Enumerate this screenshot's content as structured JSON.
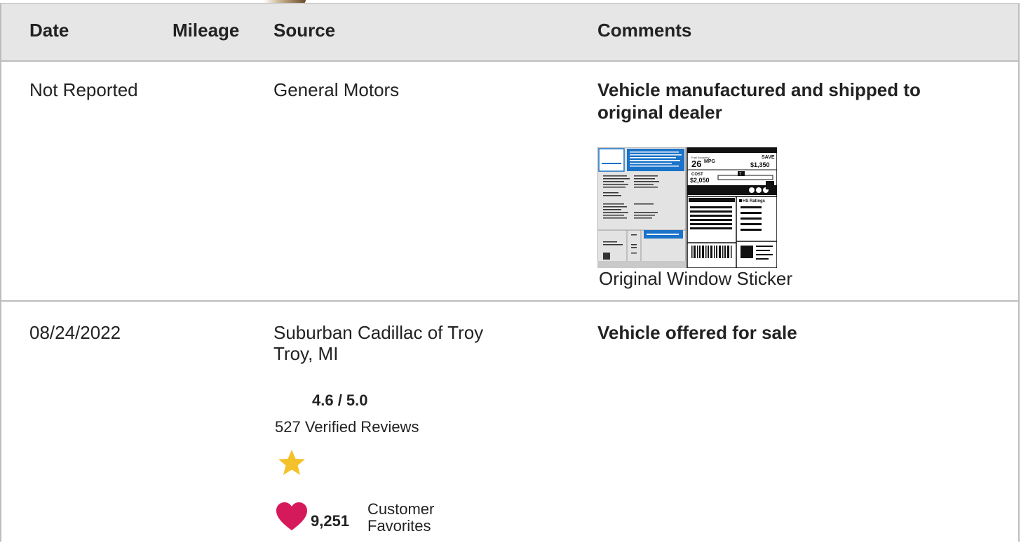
{
  "table": {
    "headers": {
      "date": "Date",
      "mileage": "Mileage",
      "source": "Source",
      "comments": "Comments"
    },
    "rows": [
      {
        "date": "Not Reported",
        "mileage": "",
        "source_name": "General Motors",
        "comment": "Vehicle manufactured and shipped to original dealer",
        "attachment": {
          "caption": "Original Window Sticker",
          "sticker_text": {
            "mpg": "26",
            "mpg_unit": "MPG",
            "save_label": "SAVE",
            "save_amount": "$1,350",
            "fuel_cost_label": "COST",
            "fuel_cost_amount": "$2,050",
            "ratings_title": "HS Ratings",
            "slider_value": "7"
          }
        }
      },
      {
        "date": "08/24/2022",
        "mileage": "",
        "source_name": "Suburban Cadillac of Troy",
        "source_location": "Troy, MI",
        "rating": "4.6 / 5.0",
        "reviews": "527 Verified Reviews",
        "favorites_count": "9,251",
        "favorites_label_line1": "Customer",
        "favorites_label_line2": "Favorites",
        "comment": "Vehicle offered for sale"
      }
    ]
  },
  "colors": {
    "header_bg": "#e6e6e6",
    "border": "#bdbdbd",
    "star": "#f5c12a",
    "heart": "#d6195a",
    "sticker_blue": "#1a73c8"
  },
  "icons": {
    "rating_star": "star-icon",
    "favorites": "heart-icon"
  }
}
